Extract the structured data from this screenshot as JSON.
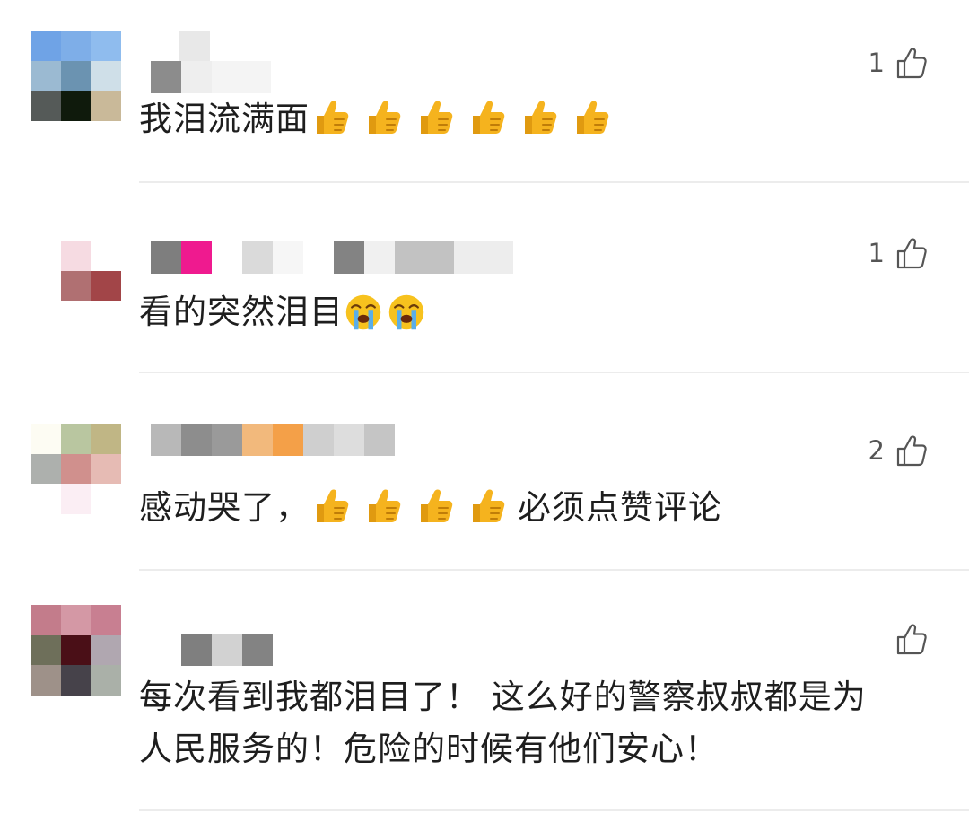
{
  "comments": [
    {
      "text": "我泪流满面",
      "likes": "1",
      "emoji": [
        "thumbs-up-icon",
        "thumbs-up-icon",
        "thumbs-up-icon",
        "thumbs-up-icon",
        "thumbs-up-icon",
        "thumbs-up-icon"
      ],
      "avatar_colors": [
        "#6fa3e6",
        "#7eaee8",
        "#8fbcee",
        "#9bbad2",
        "#6b93b1",
        "#cfdfe8",
        "#555a58",
        "#0f1a0c",
        "#c9b999"
      ]
    },
    {
      "text": "看的突然泪目",
      "likes": "1",
      "emoji": [
        "loudly-crying-face-icon",
        "loudly-crying-face-icon"
      ],
      "avatar_colors": [
        "#ffffff",
        "#f6dbe2",
        "#ffffff",
        "#ffffff",
        "#b07072",
        "#a24548",
        "#ffffff",
        "#ffffff",
        "#ffffff"
      ]
    },
    {
      "text_before": "感动哭了，",
      "text_after": "必须点赞评论",
      "likes": "2",
      "emoji": [
        "thumbs-up-icon",
        "thumbs-up-icon",
        "thumbs-up-icon",
        "thumbs-up-icon"
      ],
      "avatar_colors": [
        "#fdfcf3",
        "#b9c6a0",
        "#c0b685",
        "#adb0ad",
        "#d0908d",
        "#e6bbb4",
        "#ffffff",
        "#fbeef4",
        "#ffffff"
      ]
    },
    {
      "text": "每次看到我都泪目了！ 这么好的警察叔叔都是为\n人民服务的！危险的时候有他们安心！",
      "likes": "",
      "avatar_colors": [
        "#c37c8b",
        "#d498a5",
        "#c87f91",
        "#6e6f5a",
        "#4a0f17",
        "#b0a7b0",
        "#9e9189",
        "#46424a",
        "#aab0a8"
      ]
    }
  ],
  "colors": {
    "text": "#1e1e1e",
    "like_count": "#555555",
    "divider": "#ececec",
    "thumb_emoji": "#f5b31e"
  }
}
